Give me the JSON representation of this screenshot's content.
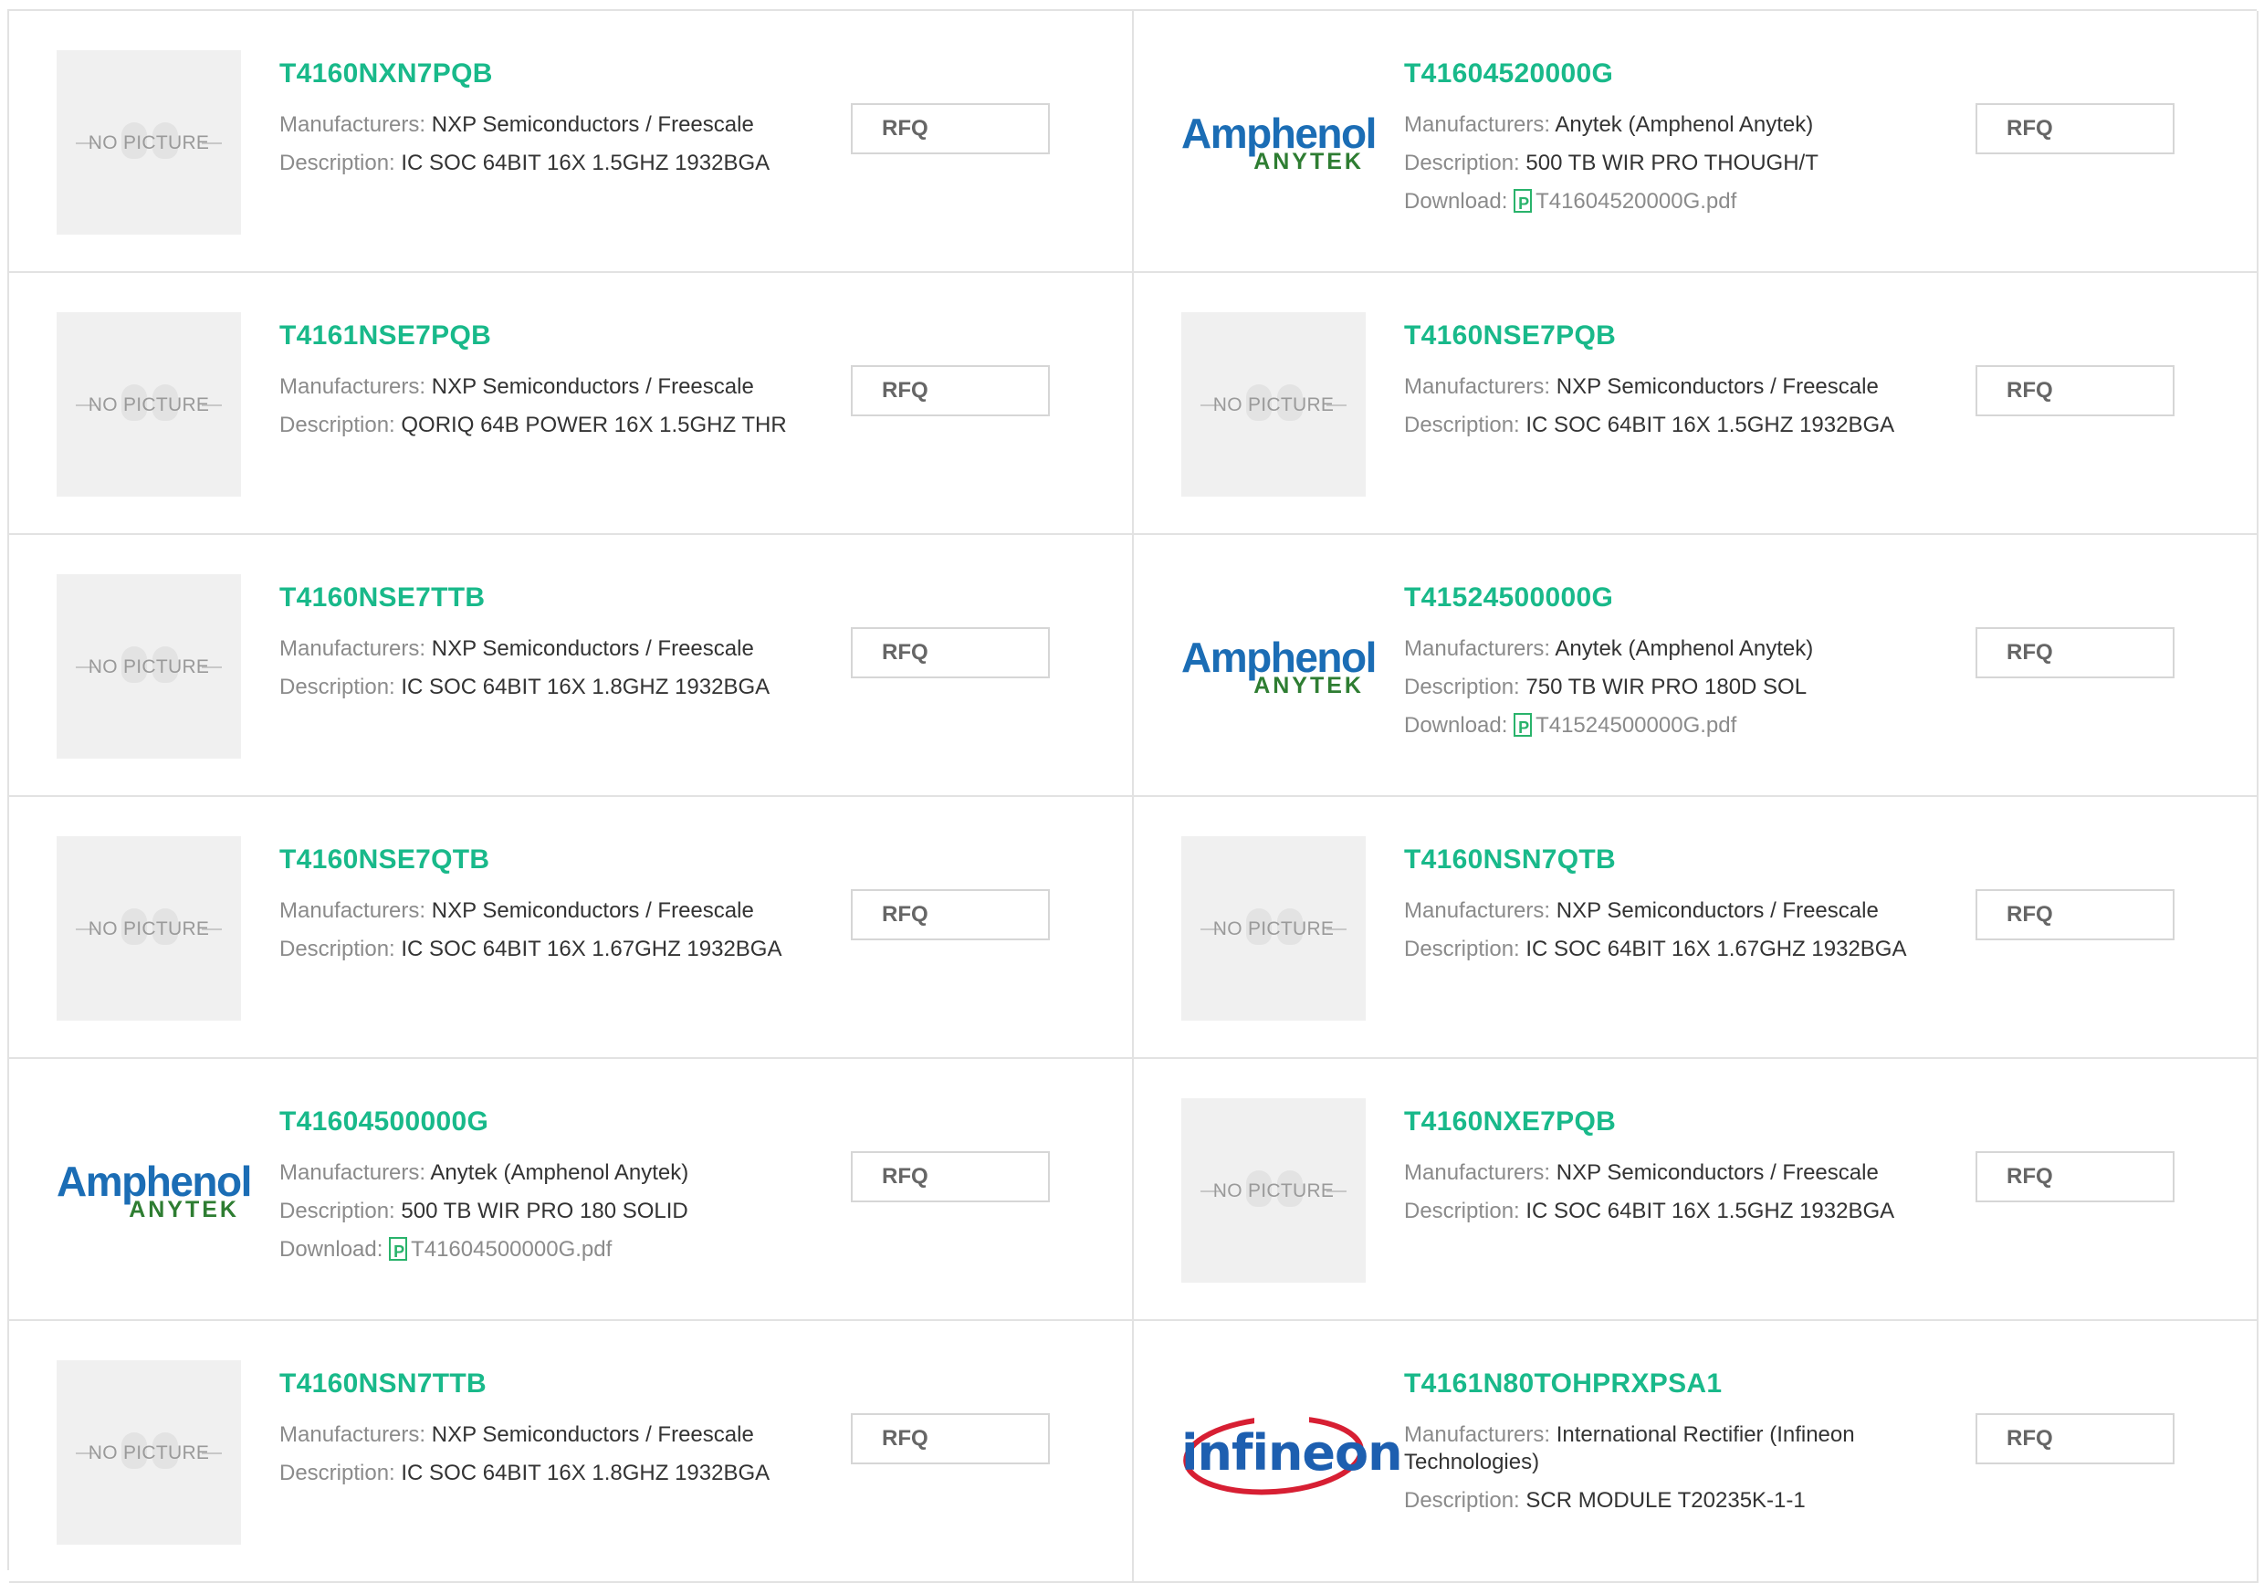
{
  "labels": {
    "manufacturers": "Manufacturers:",
    "description": "Description:",
    "download": "Download:",
    "rfq": "RFQ",
    "no_picture": "NO PICTURE",
    "amphenol_main": "Amphenol",
    "amphenol_sub": "ANYTEK",
    "infineon": "infineon"
  },
  "products": [
    {
      "part": "T4160NXN7PQB",
      "logo": "nopic",
      "manufacturer": "NXP Semiconductors / Freescale",
      "description": "IC SOC 64BIT 16X 1.5GHZ 1932BGA",
      "download": ""
    },
    {
      "part": "T41604520000G",
      "logo": "amphenol",
      "manufacturer": "Anytek (Amphenol Anytek)",
      "description": "500 TB WIR PRO THOUGH/T",
      "download": "T41604520000G.pdf"
    },
    {
      "part": "T4161NSE7PQB",
      "logo": "nopic",
      "manufacturer": "NXP Semiconductors / Freescale",
      "description": "QORIQ 64B POWER 16X 1.5GHZ THR",
      "download": ""
    },
    {
      "part": "T4160NSE7PQB",
      "logo": "nopic",
      "manufacturer": "NXP Semiconductors / Freescale",
      "description": "IC SOC 64BIT 16X 1.5GHZ 1932BGA",
      "download": ""
    },
    {
      "part": "T4160NSE7TTB",
      "logo": "nopic",
      "manufacturer": "NXP Semiconductors / Freescale",
      "description": "IC SOC 64BIT 16X 1.8GHZ 1932BGA",
      "download": ""
    },
    {
      "part": "T41524500000G",
      "logo": "amphenol",
      "manufacturer": "Anytek (Amphenol Anytek)",
      "description": "750 TB WIR PRO 180D SOL",
      "download": "T41524500000G.pdf"
    },
    {
      "part": "T4160NSE7QTB",
      "logo": "nopic",
      "manufacturer": "NXP Semiconductors / Freescale",
      "description": "IC SOC 64BIT 16X 1.67GHZ 1932BGA",
      "download": ""
    },
    {
      "part": "T4160NSN7QTB",
      "logo": "nopic",
      "manufacturer": "NXP Semiconductors / Freescale",
      "description": "IC SOC 64BIT 16X 1.67GHZ 1932BGA",
      "download": ""
    },
    {
      "part": "T41604500000G",
      "logo": "amphenol",
      "manufacturer": "Anytek (Amphenol Anytek)",
      "description": "500 TB WIR PRO 180 SOLID",
      "download": "T41604500000G.pdf"
    },
    {
      "part": "T4160NXE7PQB",
      "logo": "nopic",
      "manufacturer": "NXP Semiconductors / Freescale",
      "description": "IC SOC 64BIT 16X 1.5GHZ 1932BGA",
      "download": ""
    },
    {
      "part": "T4160NSN7TTB",
      "logo": "nopic",
      "manufacturer": "NXP Semiconductors / Freescale",
      "description": "IC SOC 64BIT 16X 1.8GHZ 1932BGA",
      "download": ""
    },
    {
      "part": "T4161N80TOHPRXPSA1",
      "logo": "infineon",
      "manufacturer": "International Rectifier (Infineon Technologies)",
      "description": "SCR MODULE T20235K-1-1",
      "download": ""
    }
  ],
  "colors": {
    "part_number": "#19b98a",
    "amphenol_blue": "#1b6db5",
    "anytek_green": "#2e7d32",
    "infineon_red": "#d71f33",
    "border": "#e2e2e2"
  }
}
